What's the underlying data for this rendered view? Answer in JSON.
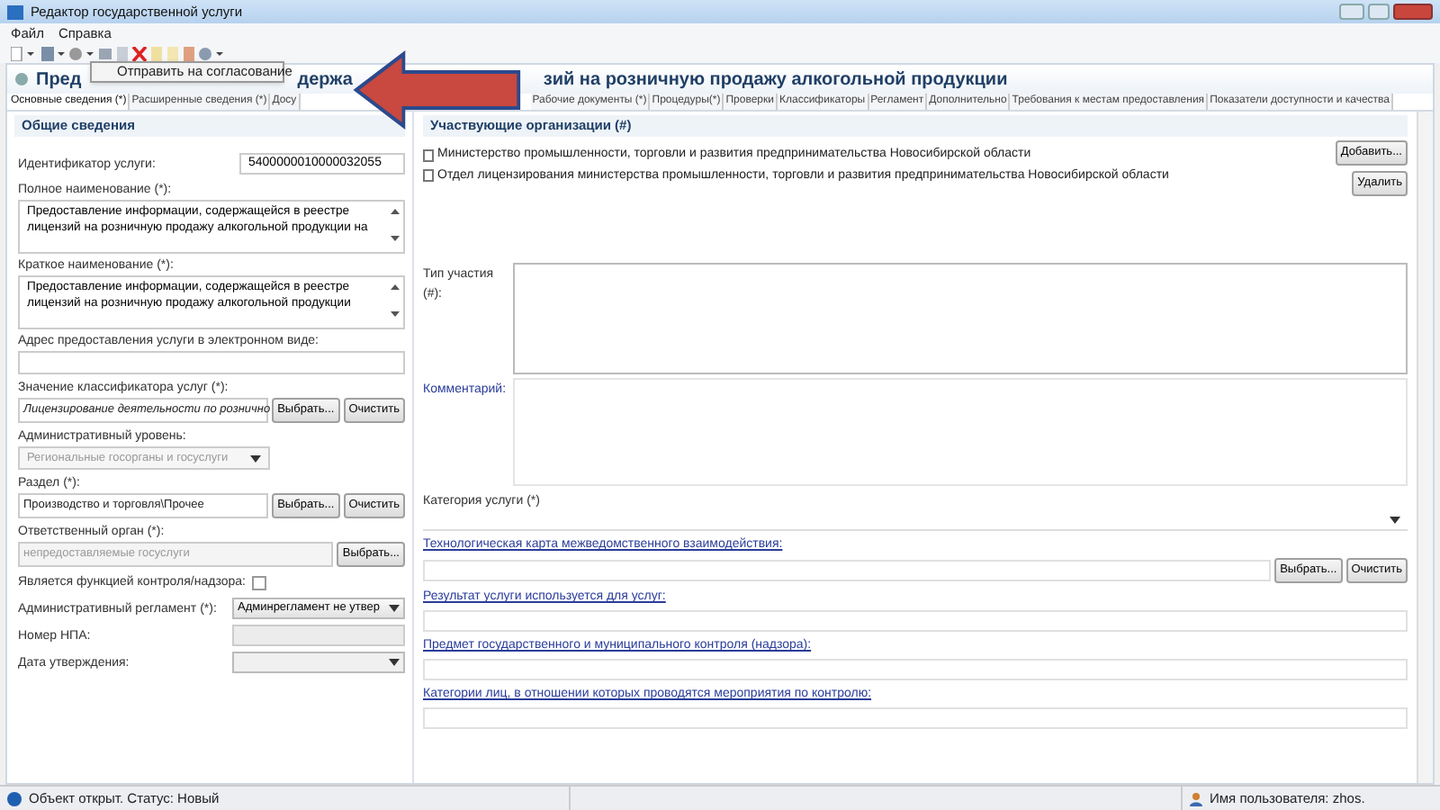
{
  "window": {
    "title": "Редактор государственной услуги"
  },
  "menu": [
    "Файл",
    "Справка"
  ],
  "popup": {
    "item": "Отправить на согласование"
  },
  "header": {
    "title_parts": [
      "Пред",
      "держа",
      "зий на розничную продажу алкогольной продукции"
    ]
  },
  "tabs": [
    {
      "label": "Основные сведения (*)",
      "selected": true
    },
    {
      "label": "Расширенные сведения (*)",
      "selected": false
    },
    {
      "label": "Досу",
      "selected": false
    },
    {
      "label": "Рабочие документы (*)",
      "selected": false
    },
    {
      "label": "Процедуры(*)",
      "selected": false
    },
    {
      "label": "Проверки",
      "selected": false
    },
    {
      "label": "Классификаторы",
      "selected": false
    },
    {
      "label": "Регламент",
      "selected": false
    },
    {
      "label": "Дополнительно",
      "selected": false
    },
    {
      "label": "Требования к местам предоставления",
      "selected": false
    },
    {
      "label": "Показатели доступности и качества",
      "selected": false
    }
  ],
  "left": {
    "title": "Общие сведения",
    "fields": [
      {
        "kind": "inline",
        "label": "Идентификатор услуги:",
        "value": "5400000010000032055"
      },
      {
        "kind": "textarea",
        "label": "Полное наименование (*):",
        "value": "Предоставление информации, содержащейся в реестре лицензий на розничную продажу алкогольной продукции на"
      },
      {
        "kind": "textarea",
        "label": "Краткое наименование (*):",
        "value": "Предоставление информации, содержащейся в реестре лицензий на розничную продажу алкогольной продукции"
      },
      {
        "kind": "text",
        "label": "Адрес предоставления услуги в электронном виде:"
      },
      {
        "kind": "picker",
        "label": "Значение классификатора услуг (*):",
        "value": "Лицензирование деятельности по розничнo",
        "italic": true,
        "disabled": false,
        "buttons": [
          "Выбрать...",
          "Очистить"
        ]
      },
      {
        "kind": "select",
        "label": "Административный уровень:",
        "value": "Региональные госорганы и госуслуги",
        "disabled": true
      },
      {
        "kind": "picker",
        "label": "Раздел (*):",
        "value": "Производство и торговля\\Прочее",
        "italic": false,
        "disabled": false,
        "buttons": [
          "Выбрать...",
          "Очистить"
        ]
      },
      {
        "kind": "picker",
        "label": "Ответственный орган (*):",
        "value": "непредоставляемые госуслуги",
        "italic": false,
        "disabled": true,
        "buttons": [
          "Выбрать..."
        ]
      },
      {
        "kind": "checkbox",
        "label": "Является функцией контроля/надзора:",
        "checked": false
      },
      {
        "kind": "inline_select",
        "label": "Административный регламент (*):",
        "value": "Админрегламент не утвер",
        "disabled": false
      },
      {
        "kind": "inline_text",
        "label": "Номер НПА:",
        "disabled": true
      },
      {
        "kind": "inline_select",
        "label": "Дата утверждения:",
        "disabled": true
      }
    ]
  },
  "right": {
    "title": "Участвующие организации (#)",
    "organizations": [
      "Министерство  промышленности, торговли и развития предпринимательства Новосибирской области",
      "Отдел лицензирования  министерства промышленности, торговли и развития предпринимательства Новосибирской области"
    ],
    "buttons": [
      "Добавить...",
      "Удалить"
    ],
    "participation_label": "Тип участия (#):",
    "comment_label": "Комментарий:",
    "category_label": "Категория услуги (*)",
    "links": [
      {
        "label": "Технологическая карта межведомственного взаимодействия:",
        "buttons": [
          "Выбрать...",
          "Очистить"
        ]
      },
      {
        "label": "Результат услуги используется для услуг:"
      },
      {
        "label": "Предмет государственного  и муниципального контроля (надзора):"
      },
      {
        "label": "Категории лиц, в отношении которых проводятся мероприятия по контролю:"
      }
    ]
  },
  "status_bar": {
    "status": "Объект открыт. Статус: Новый",
    "user": "Имя пользователя: zhos."
  }
}
